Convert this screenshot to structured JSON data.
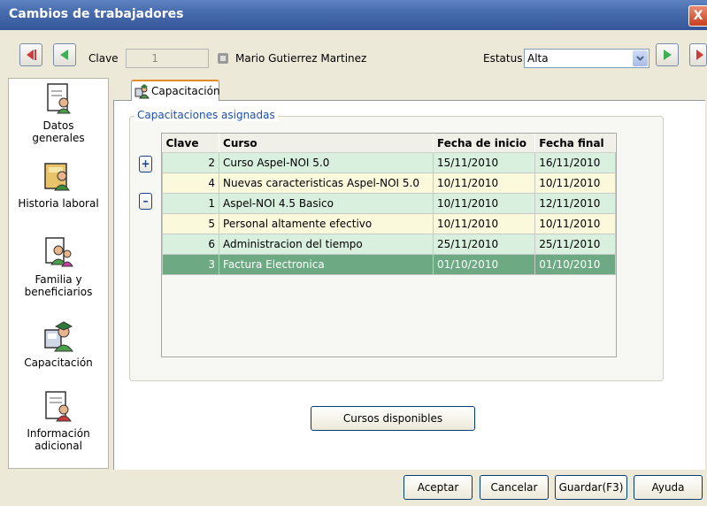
{
  "window": {
    "title": "Cambios de trabajadores",
    "close_label": "X"
  },
  "toolbar": {
    "clave_label": "Clave",
    "clave_value": "1",
    "employee_name": "Mario Gutierrez Martinez",
    "estatus_label": "Estatus",
    "estatus_value": "Alta"
  },
  "nav": [
    {
      "label1": "Datos",
      "label2": "generales",
      "icon": "document-person-icon"
    },
    {
      "label1": "Historia laboral",
      "label2": "",
      "icon": "worker-history-icon"
    },
    {
      "label1": "Familia y",
      "label2": "beneficiarios",
      "icon": "family-icon"
    },
    {
      "label1": "Capacitación",
      "label2": "",
      "icon": "training-icon"
    },
    {
      "label1": "Información",
      "label2": "adicional",
      "icon": "additional-info-icon"
    }
  ],
  "tab": {
    "label": "Capacitación"
  },
  "group": {
    "label": "Capacitaciones asignadas"
  },
  "side_buttons": {
    "add": "+",
    "remove": "–"
  },
  "grid": {
    "columns": [
      "Clave",
      "Curso",
      "Fecha de inicio",
      "Fecha final"
    ],
    "rows": [
      {
        "clave": "2",
        "curso": "Curso Aspel-NOI 5.0",
        "inicio": "15/11/2010",
        "final": "16/11/2010"
      },
      {
        "clave": "4",
        "curso": "Nuevas caracteristicas Aspel-NOI 5.0",
        "inicio": "10/11/2010",
        "final": "10/11/2010"
      },
      {
        "clave": "1",
        "curso": "Aspel-NOI 4.5 Basico",
        "inicio": "10/11/2010",
        "final": "12/11/2010"
      },
      {
        "clave": "5",
        "curso": "Personal altamente efectivo",
        "inicio": "10/11/2010",
        "final": "10/11/2010"
      },
      {
        "clave": "6",
        "curso": "Administracion del tiempo",
        "inicio": "25/11/2010",
        "final": "25/11/2010"
      },
      {
        "clave": "3",
        "curso": "Factura Electronica",
        "inicio": "01/10/2010",
        "final": "01/10/2010"
      }
    ]
  },
  "buttons": {
    "cursos_disponibles": "Cursos disponibles",
    "aceptar": "Aceptar",
    "cancelar": "Cancelar",
    "guardar": "Guardar(F3)",
    "ayuda": "Ayuda"
  },
  "colors": {
    "title_bar": "#3f63a5",
    "row_green": "#d9f0df",
    "row_yellow": "#fbf9dc",
    "row_selected": "#6daa84",
    "group_label": "#1c4fa8"
  }
}
